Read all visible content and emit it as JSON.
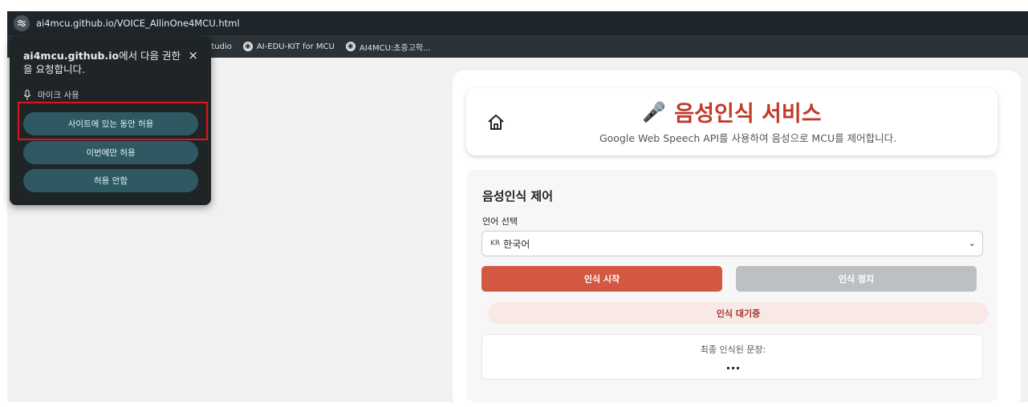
{
  "browser": {
    "url": "ai4mcu.github.io/VOICE_AllinOne4MCU.html",
    "site_info_icon": "tune-icon",
    "bookmarks": [
      {
        "label": "Studio"
      },
      {
        "label": "AI-EDU-KIT for MCU"
      },
      {
        "label": "AI4MCU:초중고학..."
      }
    ]
  },
  "permission_popup": {
    "site": "ai4mcu.github.io",
    "message": "에서 다음 권한을 요청합니다.",
    "close": "×",
    "permission": "마이크 사용",
    "buttons": {
      "allow_while_visiting": "사이트에 있는 동안 허용",
      "allow_this_time": "이번에만 허용",
      "deny": "허용 안함"
    },
    "highlight_color": "#e0141e"
  },
  "header": {
    "title": "음성인식 서비스",
    "title_icon": "🎤",
    "subtitle": "Google Web Speech API를 사용하여 음성으로 MCU를 제어합니다.",
    "accent": "#c0392b"
  },
  "control": {
    "title": "음성인식 제어",
    "language_label": "언어 선택",
    "language_flag": "KR",
    "language_value": "한국어",
    "start_button": "인식 시작",
    "stop_button": "인식 정지",
    "status": "인식 대기중",
    "result_label": "최종 인식된 문장:",
    "result_text": "...",
    "colors": {
      "start": "#d35843",
      "stop": "#bdc0c3",
      "status_bg": "#f9e9e6"
    }
  }
}
